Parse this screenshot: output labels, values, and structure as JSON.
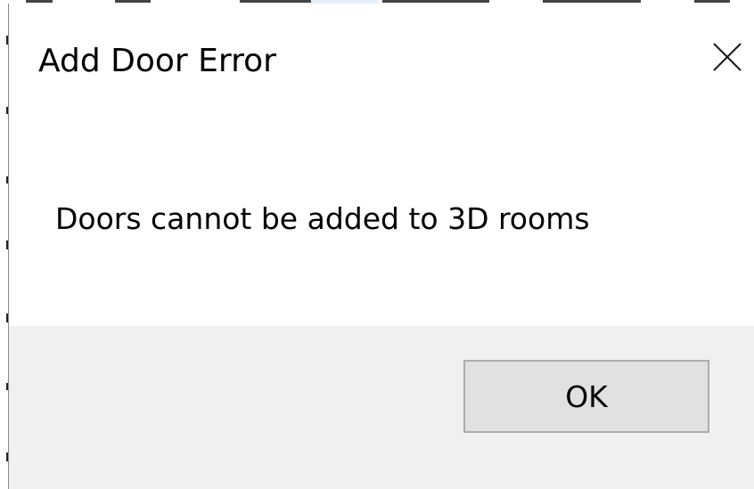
{
  "dialog": {
    "title": "Add Door Error",
    "message": "Doors cannot be added to 3D rooms",
    "ok_label": "OK",
    "close_icon": "close-icon"
  },
  "colors": {
    "footer_background": "#f0f0f0",
    "button_background": "#e1e1e1",
    "button_border": "#adadad",
    "backdrop_accent": "#e6eef8"
  }
}
